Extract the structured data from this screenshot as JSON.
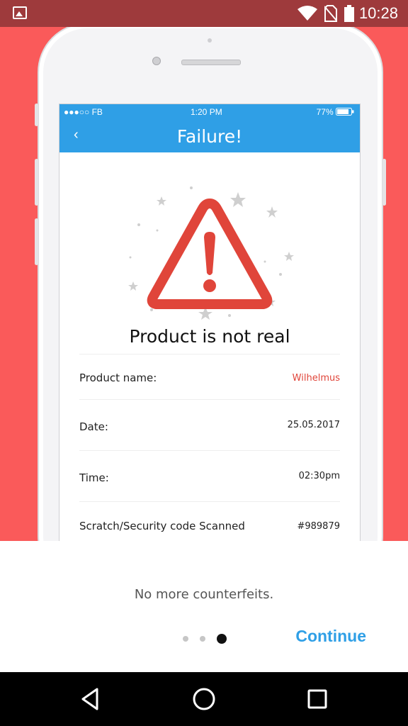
{
  "status_bar": {
    "time": "10:28",
    "icons": [
      "gallery-icon",
      "wifi-icon",
      "no-sim-icon",
      "battery-icon"
    ]
  },
  "mockup": {
    "ios_status": {
      "carrier": "●●●○○ FB",
      "time": "1:20 PM",
      "battery": "77%"
    },
    "nav": {
      "back_label": "‹",
      "title": "Failure!"
    },
    "headline": "Product is not real",
    "rows": [
      {
        "label": "Product name:",
        "value": "Wilhelmus"
      },
      {
        "label": "Date:",
        "value": "25.05.2017"
      },
      {
        "label": "Time:",
        "value": "02:30pm"
      },
      {
        "label": "Scratch/Security code Scanned",
        "value": "#989879"
      }
    ]
  },
  "onboarding": {
    "tagline": "No more counterfeits.",
    "continue_label": "Continue",
    "page_count": 3,
    "active_page": 3
  },
  "colors": {
    "hero": "#fa5a5a",
    "status_bar": "#9e3a3c",
    "ios_blue": "#2f9fe6",
    "warning_red": "#e0453a",
    "continue_blue": "#2f9fe6"
  },
  "android_nav": {
    "buttons": [
      "back-icon",
      "home-icon",
      "recents-icon"
    ]
  }
}
